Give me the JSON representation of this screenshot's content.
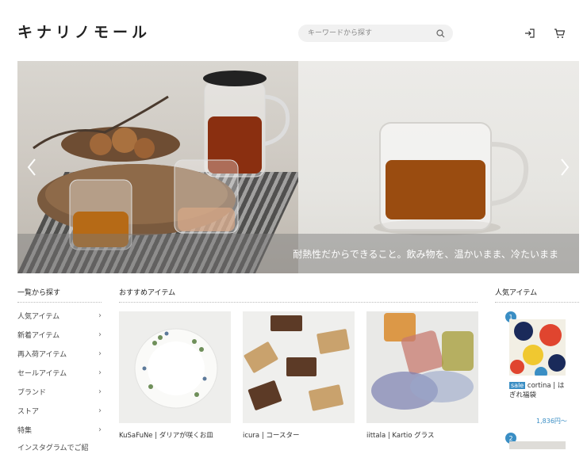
{
  "header": {
    "logo": "キナリノモール",
    "search_placeholder": "キーワードから探す"
  },
  "hero": {
    "caption": "耐熱性だからできること。飲み物を、温かいまま、冷たいまま"
  },
  "categories": {
    "title": "一覧から探す",
    "items": [
      {
        "label": "人気アイテム"
      },
      {
        "label": "新着アイテム"
      },
      {
        "label": "再入荷アイテム"
      },
      {
        "label": "セールアイテム"
      },
      {
        "label": "ブランド"
      },
      {
        "label": "ストア"
      },
      {
        "label": "特集"
      },
      {
        "label": "インスタグラムでご紹"
      }
    ]
  },
  "recommended": {
    "title": "おすすめアイテム",
    "items": [
      {
        "name": "KuSaFuNe | ダリアが咲くお皿"
      },
      {
        "name": "icura | コースター"
      },
      {
        "name": "iittala | Kartio グラス"
      }
    ]
  },
  "popular": {
    "title": "人気アイテム",
    "items": [
      {
        "rank": "1",
        "badge": "sale",
        "name": "cortina | は",
        "name2": "ぎれ福袋",
        "price": "1,836円〜"
      },
      {
        "rank": "2"
      }
    ]
  },
  "colors": {
    "accent": "#3a8ec4",
    "sale_badge": "#3a8ec4"
  }
}
